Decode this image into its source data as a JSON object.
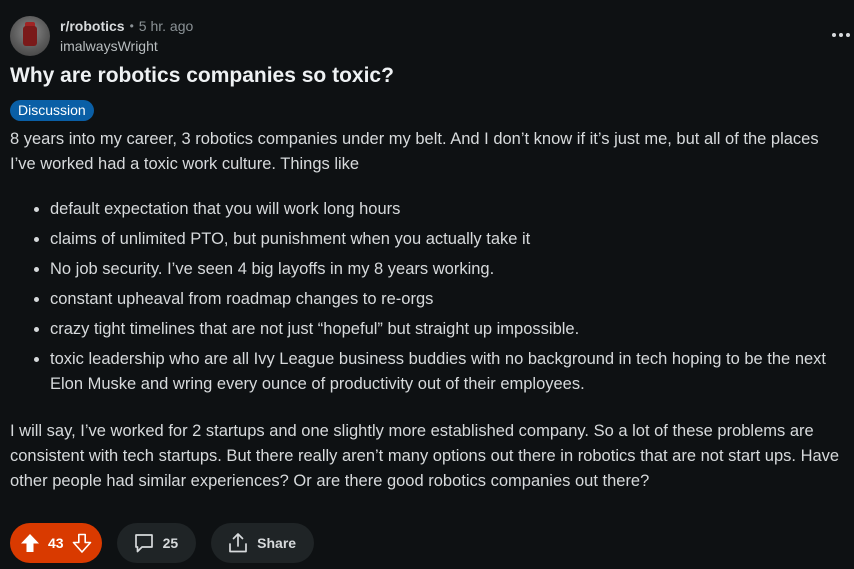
{
  "post": {
    "subreddit": "r/robotics",
    "separator": "•",
    "time": "5 hr. ago",
    "author": "imalwaysWright",
    "title": "Why are robotics companies so toxic?",
    "flair": "Discussion",
    "flair_color": "#0a5fa6",
    "intro": "8 years into my career, 3 robotics companies under my belt. And I don’t know if it’s just me, but all of the places I’ve worked had a toxic work culture. Things like",
    "bullets": [
      "default expectation that you will work long hours",
      "claims of unlimited PTO, but punishment when you actually take it",
      "No job security. I’ve seen 4 big layoffs in my 8 years working.",
      "constant upheaval from roadmap changes to re-orgs",
      "crazy tight timelines that are not just “hopeful” but straight up impossible.",
      "toxic leadership who are all Ivy League business buddies with no background in tech hoping to be the next Elon Muske and wring every ounce of productivity out of their employees."
    ],
    "outro": "I will say, I’ve worked for 2 startups and one slightly more established company. So a lot of these problems are consistent with tech startups. But there really aren’t many options out there in robotics that are not start ups. Have other people had similar experiences? Or are there good robotics companies out there?"
  },
  "actions": {
    "vote_count": "43",
    "vote_color": "#d93a00",
    "comment_count": "25",
    "share_label": "Share"
  },
  "icons": {
    "more": "more-horizontal-icon",
    "upvote": "upvote-arrow-icon",
    "downvote": "downvote-arrow-icon",
    "comment": "comment-bubble-icon",
    "share": "share-upload-icon"
  }
}
